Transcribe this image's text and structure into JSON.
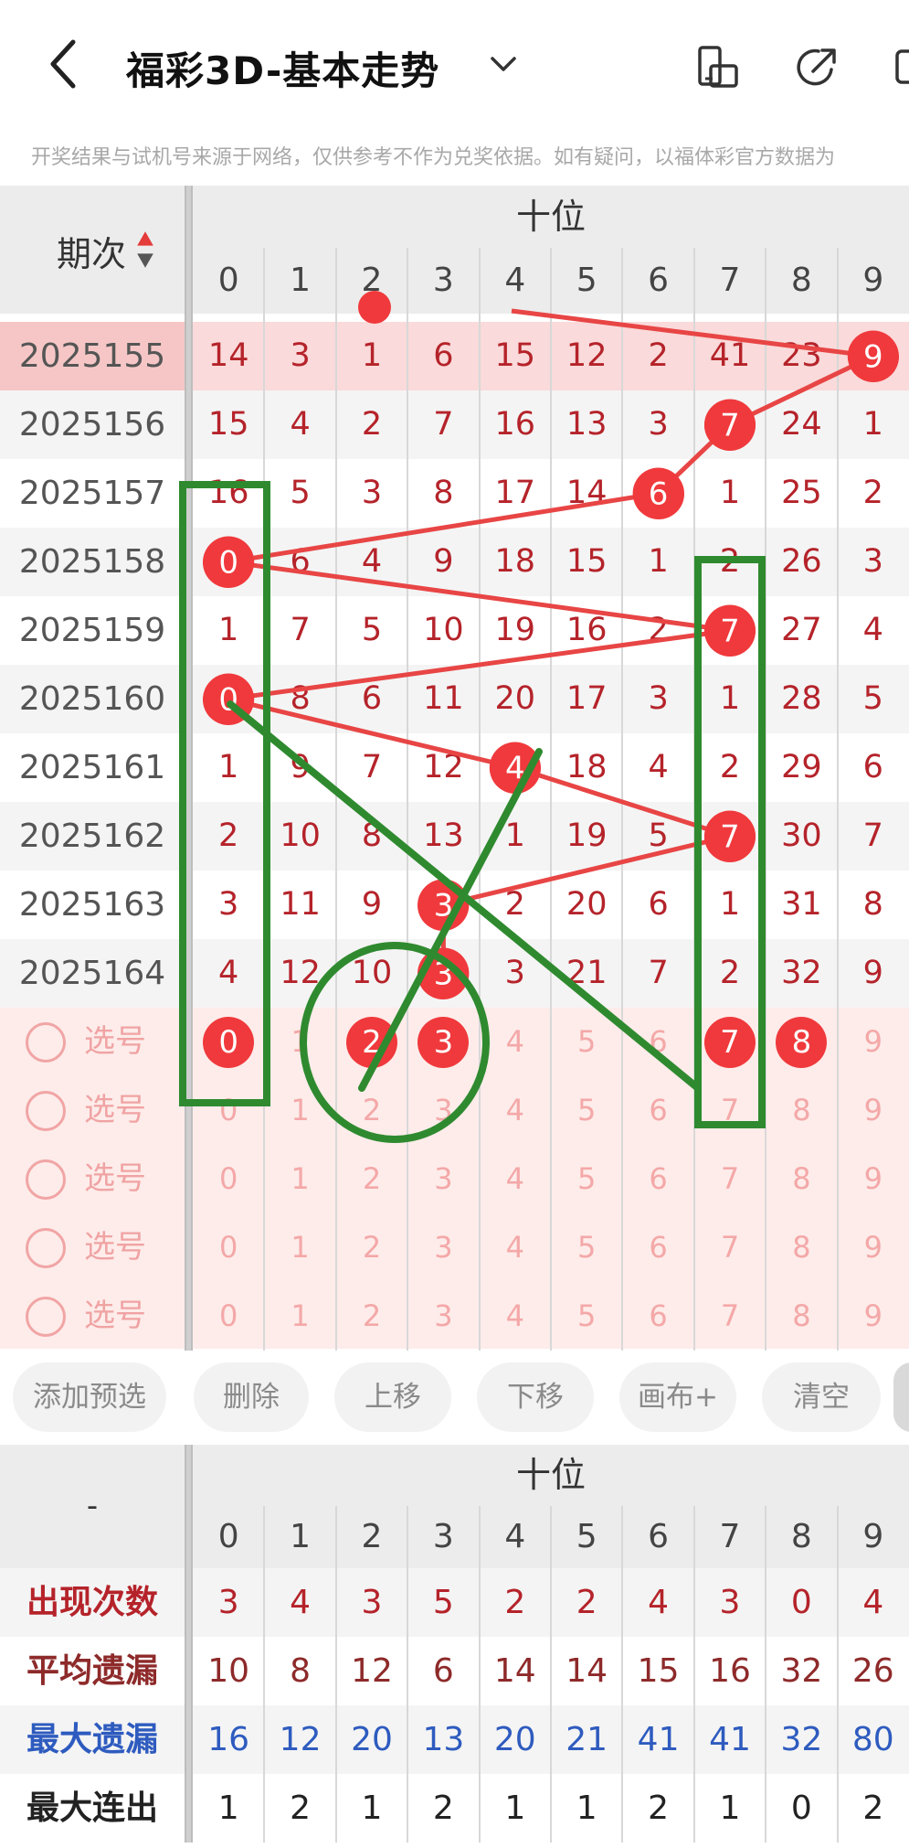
{
  "header": {
    "title": "福彩3D-基本走势",
    "notice": "开奖结果与试机号来源于网络，仅供参考不作为兑奖依据。如有疑问，以福体彩官方数据为"
  },
  "table": {
    "period_label": "期次",
    "position_label": "十位",
    "digits": [
      "0",
      "1",
      "2",
      "3",
      "4",
      "5",
      "6",
      "7",
      "8",
      "9"
    ],
    "rows": [
      {
        "period": "2025155",
        "values": [
          "14",
          "3",
          "1",
          "6",
          "15",
          "12",
          "2",
          "41",
          "23",
          "9"
        ],
        "hit": 9
      },
      {
        "period": "2025156",
        "values": [
          "15",
          "4",
          "2",
          "7",
          "16",
          "13",
          "3",
          "7",
          "24",
          "1"
        ],
        "hit": 7
      },
      {
        "period": "2025157",
        "values": [
          "16",
          "5",
          "3",
          "8",
          "17",
          "14",
          "6",
          "1",
          "25",
          "2"
        ],
        "hit": 6
      },
      {
        "period": "2025158",
        "values": [
          "0",
          "6",
          "4",
          "9",
          "18",
          "15",
          "1",
          "2",
          "26",
          "3"
        ],
        "hit": 0
      },
      {
        "period": "2025159",
        "values": [
          "1",
          "7",
          "5",
          "10",
          "19",
          "16",
          "2",
          "7",
          "27",
          "4"
        ],
        "hit": 7
      },
      {
        "period": "2025160",
        "values": [
          "0",
          "8",
          "6",
          "11",
          "20",
          "17",
          "3",
          "1",
          "28",
          "5"
        ],
        "hit": 0
      },
      {
        "period": "2025161",
        "values": [
          "1",
          "9",
          "7",
          "12",
          "4",
          "18",
          "4",
          "2",
          "29",
          "6"
        ],
        "hit": 4
      },
      {
        "period": "2025162",
        "values": [
          "2",
          "10",
          "8",
          "13",
          "1",
          "19",
          "5",
          "7",
          "30",
          "7"
        ],
        "hit": 7
      },
      {
        "period": "2025163",
        "values": [
          "3",
          "11",
          "9",
          "3",
          "2",
          "20",
          "6",
          "1",
          "31",
          "8"
        ],
        "hit": 3
      },
      {
        "period": "2025164",
        "values": [
          "4",
          "12",
          "10",
          "3",
          "3",
          "21",
          "7",
          "2",
          "32",
          "9"
        ],
        "hit": 3
      }
    ],
    "select_label": "选号",
    "select_rows": [
      {
        "selected": [
          "0",
          "2",
          "3",
          "7",
          "8"
        ]
      },
      {
        "selected": []
      },
      {
        "selected": []
      },
      {
        "selected": []
      },
      {
        "selected": []
      }
    ]
  },
  "buttons": [
    "添加预选",
    "删除",
    "上移",
    "下移",
    "画布+",
    "清空"
  ],
  "stats": {
    "corner": "-",
    "position_label": "十位",
    "rows": [
      {
        "label": "出现次数",
        "values": [
          "3",
          "4",
          "3",
          "5",
          "2",
          "2",
          "4",
          "3",
          "0",
          "4"
        ],
        "color": "#b5232a"
      },
      {
        "label": "平均遗漏",
        "values": [
          "10",
          "8",
          "12",
          "6",
          "14",
          "14",
          "15",
          "16",
          "32",
          "26"
        ],
        "color": "#8e2a2a"
      },
      {
        "label": "最大遗漏",
        "values": [
          "16",
          "12",
          "20",
          "13",
          "20",
          "21",
          "41",
          "41",
          "32",
          "80"
        ],
        "color": "#2e5bbf"
      },
      {
        "label": "最大连出",
        "values": [
          "1",
          "2",
          "1",
          "2",
          "1",
          "1",
          "2",
          "1",
          "0",
          "2"
        ],
        "color": "#222222"
      }
    ]
  },
  "colors": {
    "accent": "#f0393c",
    "trend_line": "#e84545",
    "annotation": "#2f8a2f",
    "highlight_row": "#fadada",
    "select_bg": "#fdecea"
  },
  "icons": [
    "back-arrow-icon",
    "chevron-down-icon",
    "screen-rotate-icon",
    "share-icon",
    "more-icon"
  ]
}
